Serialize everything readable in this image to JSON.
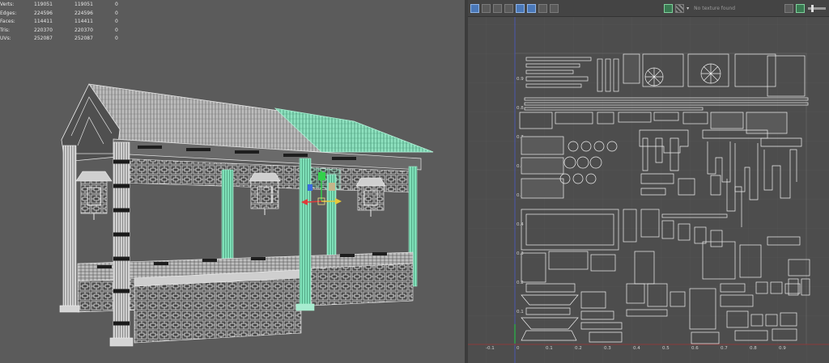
{
  "stats": {
    "rows": [
      {
        "label": "Verts:",
        "v1": "119051",
        "v2": "119051",
        "v3": "0"
      },
      {
        "label": "Edges:",
        "v1": "224596",
        "v2": "224596",
        "v3": "0"
      },
      {
        "label": "Faces:",
        "v1": "114411",
        "v2": "114411",
        "v3": "0"
      },
      {
        "label": "Tris:",
        "v1": "220370",
        "v2": "220370",
        "v3": "0"
      },
      {
        "label": "UVs:",
        "v1": "252087",
        "v2": "252087",
        "v3": "0"
      }
    ]
  },
  "uv_editor": {
    "texture_dropdown": "No texture found",
    "y_axis_labels": [
      "0.9",
      "0.8",
      "0.7",
      "0.6",
      "0.5",
      "0.4",
      "0.3",
      "0.2",
      "0.1",
      "0"
    ],
    "x_axis_labels": [
      "-0.1",
      "0",
      "0.1",
      "0.2",
      "0.3",
      "0.4",
      "0.5",
      "0.6",
      "0.7",
      "0.8",
      "0.9"
    ]
  },
  "colors": {
    "viewport_bg": "#5b5b5b",
    "uv_bg": "#4d4d4d",
    "selection_green": "#6fd9b1",
    "wire_white": "#f0f0f0"
  },
  "icons": [
    "translate-gizmo-icon",
    "uv-toolbar-icons",
    "checker-icon",
    "texture-toggle-icon"
  ]
}
